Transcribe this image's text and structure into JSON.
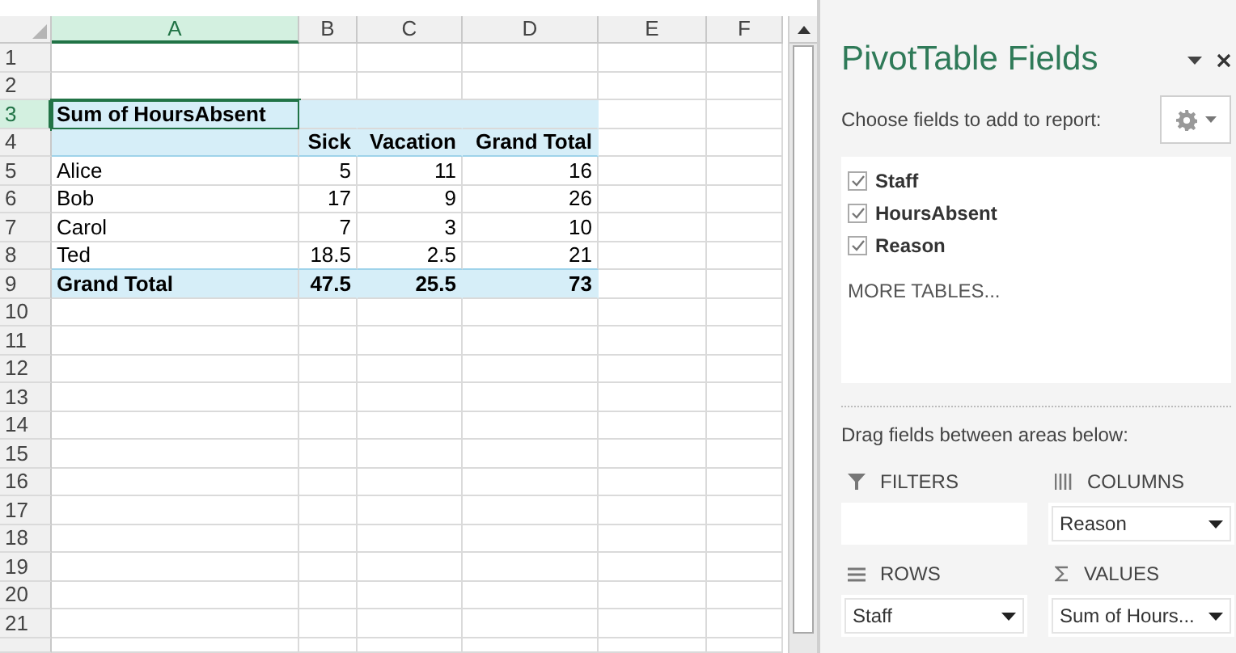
{
  "sheet": {
    "columns": [
      {
        "label": "A",
        "selected": true
      },
      {
        "label": "B",
        "selected": false
      },
      {
        "label": "C",
        "selected": false
      },
      {
        "label": "D",
        "selected": false
      },
      {
        "label": "E",
        "selected": false
      },
      {
        "label": "F",
        "selected": false
      }
    ],
    "row_numbers": [
      {
        "label": "1",
        "selected": false
      },
      {
        "label": "2",
        "selected": false
      },
      {
        "label": "3",
        "selected": true
      },
      {
        "label": "4",
        "selected": false
      },
      {
        "label": "5",
        "selected": false
      },
      {
        "label": "6",
        "selected": false
      },
      {
        "label": "7",
        "selected": false
      },
      {
        "label": "8",
        "selected": false
      },
      {
        "label": "9",
        "selected": false
      },
      {
        "label": "10",
        "selected": false
      },
      {
        "label": "11",
        "selected": false
      },
      {
        "label": "12",
        "selected": false
      },
      {
        "label": "13",
        "selected": false
      },
      {
        "label": "14",
        "selected": false
      },
      {
        "label": "15",
        "selected": false
      },
      {
        "label": "16",
        "selected": false
      },
      {
        "label": "17",
        "selected": false
      },
      {
        "label": "18",
        "selected": false
      },
      {
        "label": "19",
        "selected": false
      },
      {
        "label": "20",
        "selected": false
      },
      {
        "label": "21",
        "selected": false
      }
    ],
    "pivot": {
      "title": "Sum of HoursAbsent",
      "title_selected": true,
      "columns": [
        "Sick",
        "Vacation",
        "Grand Total"
      ],
      "rows": [
        {
          "label": "Alice",
          "values": [
            "5",
            "11",
            "16"
          ]
        },
        {
          "label": "Bob",
          "values": [
            "17",
            "9",
            "26"
          ]
        },
        {
          "label": "Carol",
          "values": [
            "7",
            "3",
            "10"
          ]
        },
        {
          "label": "Ted",
          "values": [
            "18.5",
            "2.5",
            "21"
          ]
        }
      ],
      "total": {
        "label": "Grand Total",
        "values": [
          "47.5",
          "25.5",
          "73"
        ]
      }
    }
  },
  "panel": {
    "title": "PivotTable Fields",
    "prompt": "Choose fields to add to report:",
    "fields": [
      {
        "label": "Staff",
        "checked": true
      },
      {
        "label": "HoursAbsent",
        "checked": true
      },
      {
        "label": "Reason",
        "checked": true
      }
    ],
    "more_tables": "MORE TABLES...",
    "drag_hint": "Drag fields between areas below:",
    "areas": [
      {
        "kind": "filters",
        "label": "FILTERS"
      },
      {
        "kind": "columns",
        "label": "COLUMNS",
        "items": [
          "Reason"
        ]
      },
      {
        "kind": "rows",
        "label": "ROWS",
        "items": [
          "Staff"
        ]
      },
      {
        "kind": "values",
        "label": "VALUES",
        "items": [
          "Sum of Hours..."
        ]
      }
    ]
  }
}
